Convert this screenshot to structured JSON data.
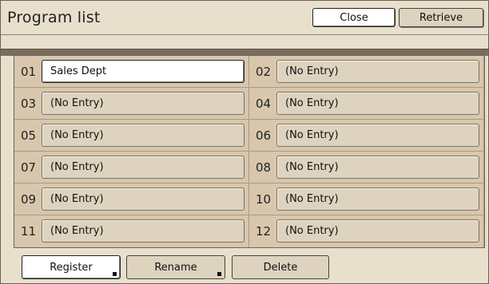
{
  "header": {
    "title": "Program list",
    "close_label": "Close",
    "retrieve_label": "Retrieve"
  },
  "programs": [
    {
      "num": "01",
      "name": "Sales Dept"
    },
    {
      "num": "02",
      "name": "(No Entry)"
    },
    {
      "num": "03",
      "name": "(No Entry)"
    },
    {
      "num": "04",
      "name": "(No Entry)"
    },
    {
      "num": "05",
      "name": "(No Entry)"
    },
    {
      "num": "06",
      "name": "(No Entry)"
    },
    {
      "num": "07",
      "name": "(No Entry)"
    },
    {
      "num": "08",
      "name": "(No Entry)"
    },
    {
      "num": "09",
      "name": "(No Entry)"
    },
    {
      "num": "10",
      "name": "(No Entry)"
    },
    {
      "num": "11",
      "name": "(No Entry)"
    },
    {
      "num": "12",
      "name": "(No Entry)"
    }
  ],
  "footer": {
    "register_label": "Register",
    "rename_label": "Rename",
    "delete_label": "Delete"
  },
  "colors": {
    "background": "#e8e0cc",
    "grid_background": "#d8c7ad",
    "selected_field": "#ffffff"
  }
}
